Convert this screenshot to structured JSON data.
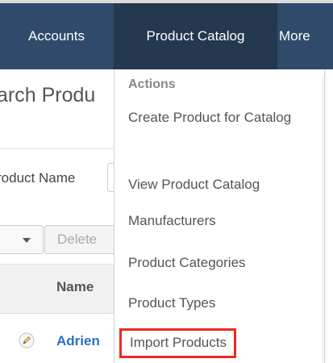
{
  "nav": {
    "accounts": "Accounts",
    "product_catalog": "Product Catalog",
    "more": "More"
  },
  "page": {
    "title": "arch Produ",
    "field_label": "roduct Name",
    "delete_label": "Delete",
    "column_name": "Name",
    "row_name": "Adrien"
  },
  "menu": {
    "header": "Actions",
    "items": [
      "Create Product for Catalog",
      "View Product Catalog",
      "Manufacturers",
      "Product Categories",
      "Product Types",
      "Import Products"
    ],
    "highlight_color": "#ee2b1c"
  },
  "colors": {
    "nav_bg": "#2f4a6b",
    "nav_active_bg": "#24384f",
    "link": "#2a6fc1"
  },
  "icons": {
    "row_edit": "pencil-icon",
    "dropdown": "caret-down-icon"
  }
}
